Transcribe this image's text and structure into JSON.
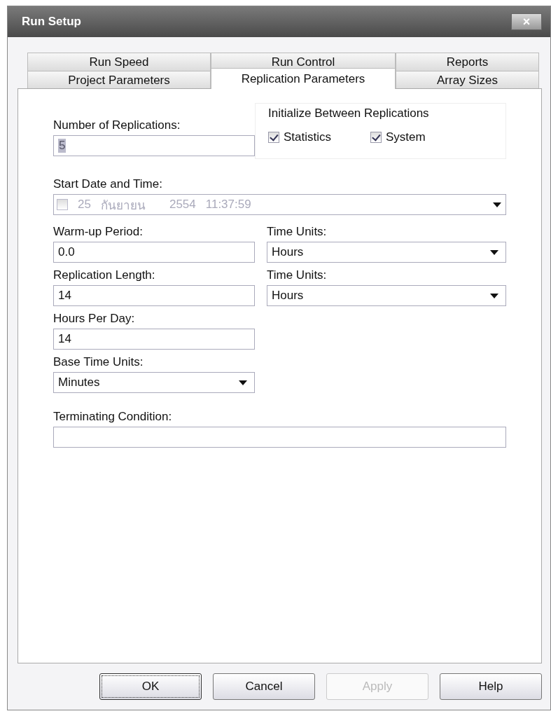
{
  "window": {
    "title": "Run Setup",
    "close": "×"
  },
  "tab_rows": [
    [
      {
        "label": "Run Speed",
        "selected": false
      },
      {
        "label": "Run Control",
        "selected": false
      },
      {
        "label": "Reports",
        "selected": false
      }
    ],
    [
      {
        "label": "Project Parameters",
        "selected": false
      },
      {
        "label": "Replication Parameters",
        "selected": true
      },
      {
        "label": "Array Sizes",
        "selected": false
      }
    ]
  ],
  "replications": {
    "label": "Number of Replications:",
    "value": "5"
  },
  "initialize": {
    "title": "Initialize Between Replications",
    "options": [
      {
        "label": "Statistics",
        "checked": true
      },
      {
        "label": "System",
        "checked": true
      }
    ]
  },
  "start": {
    "label": "Start Date and Time:",
    "checked": false,
    "day": "25",
    "month": "กันยายน",
    "year": "2554",
    "time": "11:37:59",
    "disabled": true
  },
  "warmup": {
    "label": "Warm-up Period:",
    "value": "0.0",
    "units_label": "Time Units:",
    "units": "Hours"
  },
  "length": {
    "label": "Replication Length:",
    "value": "14",
    "units_label": "Time Units:",
    "units": "Hours"
  },
  "hours_per_day": {
    "label": "Hours Per Day:",
    "value": "14"
  },
  "base_units": {
    "label": "Base Time Units:",
    "value": "Minutes"
  },
  "terminating": {
    "label": "Terminating Condition:"
  },
  "buttons": [
    {
      "label": "OK",
      "disabled": false,
      "default": true
    },
    {
      "label": "Cancel",
      "disabled": false,
      "default": false
    },
    {
      "label": "Apply",
      "disabled": true,
      "default": false
    },
    {
      "label": "Help",
      "disabled": false,
      "default": false
    }
  ]
}
